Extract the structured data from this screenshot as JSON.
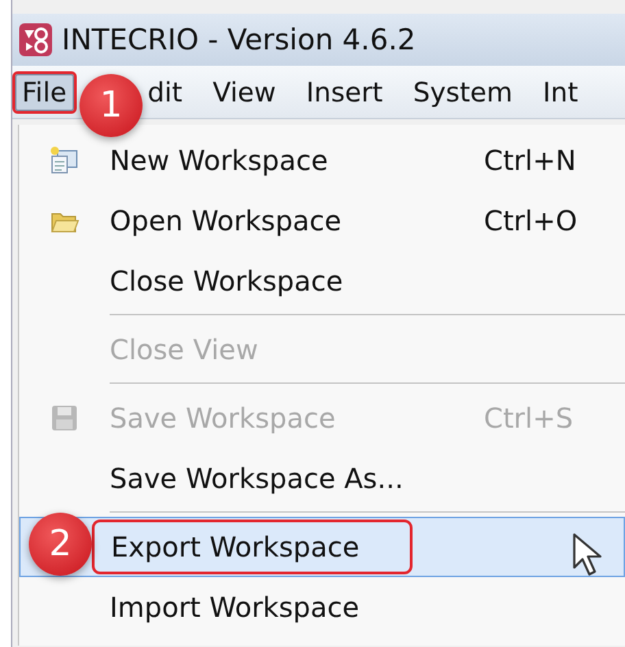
{
  "window": {
    "title": "INTECRIO - Version 4.6.2"
  },
  "menubar": [
    {
      "label": "File",
      "selected": true
    },
    {
      "label": "dit",
      "selected": false
    },
    {
      "label": "View",
      "selected": false
    },
    {
      "label": "Insert",
      "selected": false
    },
    {
      "label": "System",
      "selected": false
    },
    {
      "label": "Int",
      "selected": false
    }
  ],
  "menu": [
    {
      "kind": "item",
      "label": "New Workspace",
      "shortcut": "Ctrl+N",
      "disabled": false,
      "selected": false
    },
    {
      "kind": "item",
      "label": "Open Workspace",
      "shortcut": "Ctrl+O",
      "disabled": false,
      "selected": false
    },
    {
      "kind": "item",
      "label": "Close Workspace",
      "disabled": false,
      "selected": false
    },
    {
      "kind": "separator"
    },
    {
      "kind": "item",
      "label": "Close View",
      "disabled": true,
      "selected": false
    },
    {
      "kind": "separator"
    },
    {
      "kind": "item",
      "label": "Save Workspace",
      "shortcut": "Ctrl+S",
      "disabled": true,
      "selected": false
    },
    {
      "kind": "item",
      "label": "Save Workspace As...",
      "disabled": false,
      "selected": false
    },
    {
      "kind": "separator"
    },
    {
      "kind": "item",
      "label": "Export Workspace",
      "disabled": false,
      "selected": true
    },
    {
      "kind": "item",
      "label": "Import Workspace",
      "disabled": false,
      "selected": false
    }
  ],
  "callouts": [
    {
      "label": "1"
    },
    {
      "label": "2"
    }
  ]
}
